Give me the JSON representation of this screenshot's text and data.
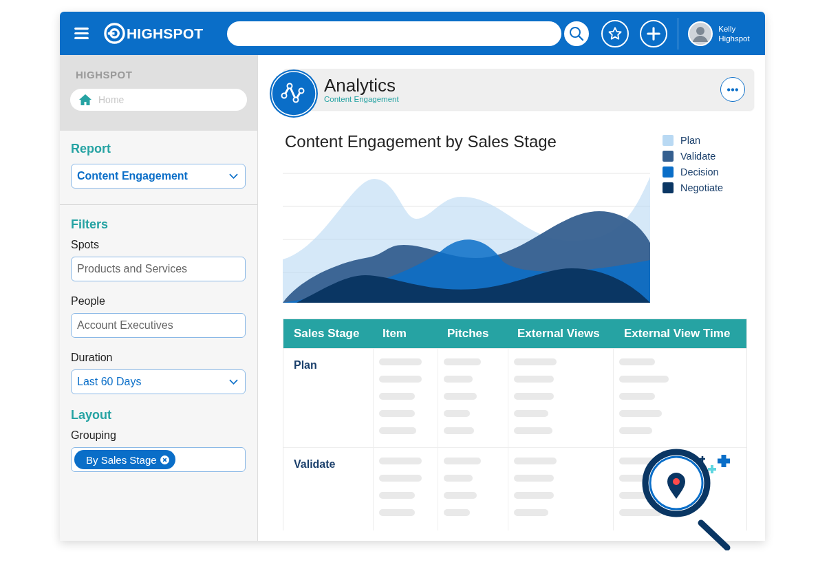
{
  "header": {
    "logo": "HIGHSPOT",
    "user": [
      "Kelly",
      "Highspot"
    ]
  },
  "sidebar": {
    "brand": "HIGHSPOT",
    "home_search": {
      "placeholder": "Home"
    },
    "sections": [
      {
        "heading": "Report",
        "fields": [
          {
            "kind": "select",
            "value": "Content Engagement"
          }
        ]
      },
      {
        "heading": "Filters",
        "fields": [
          {
            "label": "Spots",
            "kind": "text",
            "value": "Products and Services"
          },
          {
            "label": "People",
            "kind": "text",
            "value": "Account Executives"
          },
          {
            "label": "Duration",
            "kind": "select",
            "value": "Last 60 Days"
          }
        ]
      },
      {
        "heading": "Layout",
        "fields": [
          {
            "label": "Grouping",
            "kind": "chips",
            "chips": [
              "By Sales Stage"
            ]
          }
        ]
      }
    ]
  },
  "page_header": {
    "title": "Analytics",
    "subtitle": "Content Engagement"
  },
  "chart": {
    "title": "Content Engagement by Sales Stage",
    "legend": [
      {
        "name": "Plan",
        "color": "#b9d9f3"
      },
      {
        "name": "Validate",
        "color": "#355f8f"
      },
      {
        "name": "Decision",
        "color": "#0a6ec8"
      },
      {
        "name": "Negotiate",
        "color": "#0a3663"
      }
    ]
  },
  "table": {
    "columns": [
      "Sales Stage",
      "Item",
      "Pitches",
      "External Views",
      "External View Time"
    ],
    "rows": [
      {
        "stage": "Plan"
      },
      {
        "stage": "Validate"
      }
    ]
  }
}
